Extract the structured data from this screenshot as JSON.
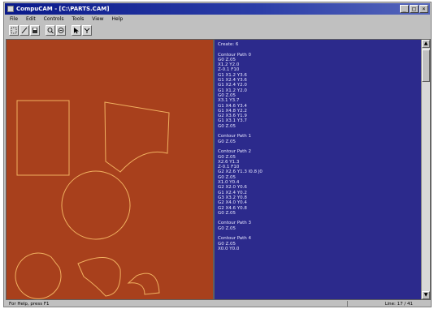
{
  "window": {
    "title": "CompuCAM - [C:\\PARTS.CAM]",
    "controls": [
      "_",
      "□",
      "×"
    ]
  },
  "menu": [
    "File",
    "Edit",
    "Controls",
    "Tools",
    "View",
    "Help"
  ],
  "toolbar": {
    "icons": [
      "select-tool-icon",
      "line-tool-icon",
      "save-icon",
      "zoom-in-icon",
      "zoom-out-icon",
      "pointer-icon",
      "settings-icon"
    ]
  },
  "colors": {
    "canvas": "#a8401c",
    "geometry": "#f0b060",
    "code_bg": "#2c2a8c",
    "code_text": "#e6e6ff"
  },
  "code": [
    "Create: 6",
    "",
    "Contour Path 0",
    "G0 Z.05",
    "X1.2 Y2.0",
    "Z-0.1 F10",
    "G1 X1.2 Y3.6",
    "G1 X2.4 Y3.6",
    "G1 X2.4 Y2.0",
    "G1 X1.2 Y2.0",
    "G0 Z.05",
    "X3.1 Y3.7",
    "G1 X4.6 Y3.4",
    "G1 X4.8 Y2.2",
    "G2 X3.6 Y1.9",
    "G1 X3.1 Y3.7",
    "G0 Z.05",
    "",
    "Contour Path 1",
    "G0 Z.05",
    "",
    "Contour Path 2",
    "G0 Z.05",
    "X2.6 Y1.3",
    "Z-0.1 F10",
    "G2 X2.6 Y1.3 I0.8 J0",
    "G0 Z.05",
    "X1.0 Y0.4",
    "G2 X2.0 Y0.6",
    "G1 X2.4 Y0.2",
    "G3 X3.2 Y0.8",
    "G2 X4.0 Y0.4",
    "G2 X4.6 Y0.8",
    "G0 Z.05",
    "",
    "Contour Path 3",
    "G0 Z.05",
    "",
    "Contour Path 4",
    "G0 Z.05",
    "X0.0 Y0.0"
  ],
  "status": {
    "left": "For Help, press F1",
    "right": "Line: 17 / 41"
  }
}
